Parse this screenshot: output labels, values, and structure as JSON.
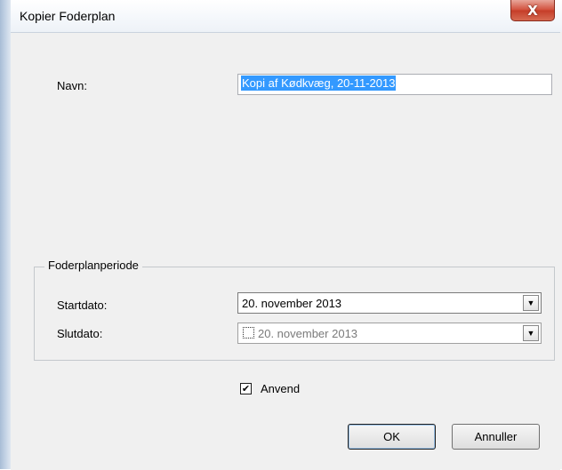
{
  "window": {
    "title": "Kopier Foderplan",
    "close_glyph": "X"
  },
  "form": {
    "navn_label": "Navn:",
    "navn_value": "Kopi af Kødkvæg, 20-11-2013"
  },
  "period": {
    "group_title": "Foderplanperiode",
    "start_label": "Startdato:",
    "start_value": "20. november 2013",
    "end_label": "Slutdato:",
    "end_value": "20. november 2013",
    "end_checked": false
  },
  "apply": {
    "label": "Anvend",
    "checked": true
  },
  "buttons": {
    "ok_label": "OK",
    "cancel_label": "Annuller"
  },
  "colors": {
    "selection": "#3399ff",
    "close_button": "#c53d28"
  },
  "icons": {
    "close": "close-icon",
    "dropdown": "chevron-down-icon",
    "check": "check-icon"
  }
}
